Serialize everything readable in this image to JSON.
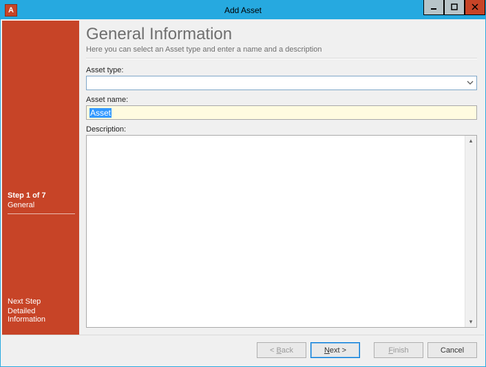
{
  "window": {
    "title": "Add Asset",
    "app_icon_letter": "A"
  },
  "sidebar": {
    "step_counter": "Step 1 of 7",
    "current_step_name": "General",
    "next_step_label": "Next Step",
    "next_step_name": "Detailed Information"
  },
  "header": {
    "title": "General Information",
    "subtitle": "Here you can select an Asset type and enter a name and a description"
  },
  "form": {
    "asset_type_label": "Asset type:",
    "asset_type_value": "",
    "asset_name_label": "Asset name:",
    "asset_name_value": "Asset",
    "description_label": "Description:",
    "description_value": ""
  },
  "footer": {
    "back_prefix": "< ",
    "back_u": "B",
    "back_suffix": "ack",
    "next_u": "N",
    "next_suffix": "ext >",
    "finish_u": "F",
    "finish_suffix": "inish",
    "cancel": "Cancel"
  }
}
